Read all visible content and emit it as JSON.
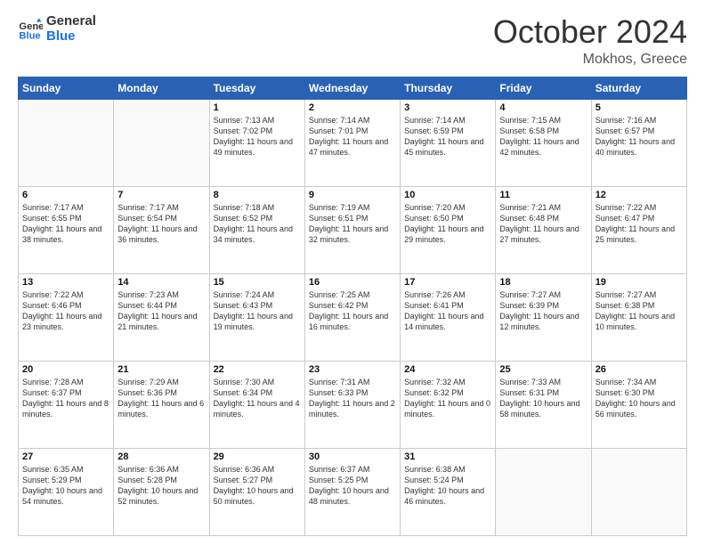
{
  "header": {
    "logo_line1": "General",
    "logo_line2": "Blue",
    "month": "October 2024",
    "location": "Mokhos, Greece"
  },
  "days_of_week": [
    "Sunday",
    "Monday",
    "Tuesday",
    "Wednesday",
    "Thursday",
    "Friday",
    "Saturday"
  ],
  "weeks": [
    [
      {
        "day": "",
        "info": ""
      },
      {
        "day": "",
        "info": ""
      },
      {
        "day": "1",
        "info": "Sunrise: 7:13 AM\nSunset: 7:02 PM\nDaylight: 11 hours and 49 minutes."
      },
      {
        "day": "2",
        "info": "Sunrise: 7:14 AM\nSunset: 7:01 PM\nDaylight: 11 hours and 47 minutes."
      },
      {
        "day": "3",
        "info": "Sunrise: 7:14 AM\nSunset: 6:59 PM\nDaylight: 11 hours and 45 minutes."
      },
      {
        "day": "4",
        "info": "Sunrise: 7:15 AM\nSunset: 6:58 PM\nDaylight: 11 hours and 42 minutes."
      },
      {
        "day": "5",
        "info": "Sunrise: 7:16 AM\nSunset: 6:57 PM\nDaylight: 11 hours and 40 minutes."
      }
    ],
    [
      {
        "day": "6",
        "info": "Sunrise: 7:17 AM\nSunset: 6:55 PM\nDaylight: 11 hours and 38 minutes."
      },
      {
        "day": "7",
        "info": "Sunrise: 7:17 AM\nSunset: 6:54 PM\nDaylight: 11 hours and 36 minutes."
      },
      {
        "day": "8",
        "info": "Sunrise: 7:18 AM\nSunset: 6:52 PM\nDaylight: 11 hours and 34 minutes."
      },
      {
        "day": "9",
        "info": "Sunrise: 7:19 AM\nSunset: 6:51 PM\nDaylight: 11 hours and 32 minutes."
      },
      {
        "day": "10",
        "info": "Sunrise: 7:20 AM\nSunset: 6:50 PM\nDaylight: 11 hours and 29 minutes."
      },
      {
        "day": "11",
        "info": "Sunrise: 7:21 AM\nSunset: 6:48 PM\nDaylight: 11 hours and 27 minutes."
      },
      {
        "day": "12",
        "info": "Sunrise: 7:22 AM\nSunset: 6:47 PM\nDaylight: 11 hours and 25 minutes."
      }
    ],
    [
      {
        "day": "13",
        "info": "Sunrise: 7:22 AM\nSunset: 6:46 PM\nDaylight: 11 hours and 23 minutes."
      },
      {
        "day": "14",
        "info": "Sunrise: 7:23 AM\nSunset: 6:44 PM\nDaylight: 11 hours and 21 minutes."
      },
      {
        "day": "15",
        "info": "Sunrise: 7:24 AM\nSunset: 6:43 PM\nDaylight: 11 hours and 19 minutes."
      },
      {
        "day": "16",
        "info": "Sunrise: 7:25 AM\nSunset: 6:42 PM\nDaylight: 11 hours and 16 minutes."
      },
      {
        "day": "17",
        "info": "Sunrise: 7:26 AM\nSunset: 6:41 PM\nDaylight: 11 hours and 14 minutes."
      },
      {
        "day": "18",
        "info": "Sunrise: 7:27 AM\nSunset: 6:39 PM\nDaylight: 11 hours and 12 minutes."
      },
      {
        "day": "19",
        "info": "Sunrise: 7:27 AM\nSunset: 6:38 PM\nDaylight: 11 hours and 10 minutes."
      }
    ],
    [
      {
        "day": "20",
        "info": "Sunrise: 7:28 AM\nSunset: 6:37 PM\nDaylight: 11 hours and 8 minutes."
      },
      {
        "day": "21",
        "info": "Sunrise: 7:29 AM\nSunset: 6:36 PM\nDaylight: 11 hours and 6 minutes."
      },
      {
        "day": "22",
        "info": "Sunrise: 7:30 AM\nSunset: 6:34 PM\nDaylight: 11 hours and 4 minutes."
      },
      {
        "day": "23",
        "info": "Sunrise: 7:31 AM\nSunset: 6:33 PM\nDaylight: 11 hours and 2 minutes."
      },
      {
        "day": "24",
        "info": "Sunrise: 7:32 AM\nSunset: 6:32 PM\nDaylight: 11 hours and 0 minutes."
      },
      {
        "day": "25",
        "info": "Sunrise: 7:33 AM\nSunset: 6:31 PM\nDaylight: 10 hours and 58 minutes."
      },
      {
        "day": "26",
        "info": "Sunrise: 7:34 AM\nSunset: 6:30 PM\nDaylight: 10 hours and 56 minutes."
      }
    ],
    [
      {
        "day": "27",
        "info": "Sunrise: 6:35 AM\nSunset: 5:29 PM\nDaylight: 10 hours and 54 minutes."
      },
      {
        "day": "28",
        "info": "Sunrise: 6:36 AM\nSunset: 5:28 PM\nDaylight: 10 hours and 52 minutes."
      },
      {
        "day": "29",
        "info": "Sunrise: 6:36 AM\nSunset: 5:27 PM\nDaylight: 10 hours and 50 minutes."
      },
      {
        "day": "30",
        "info": "Sunrise: 6:37 AM\nSunset: 5:25 PM\nDaylight: 10 hours and 48 minutes."
      },
      {
        "day": "31",
        "info": "Sunrise: 6:38 AM\nSunset: 5:24 PM\nDaylight: 10 hours and 46 minutes."
      },
      {
        "day": "",
        "info": ""
      },
      {
        "day": "",
        "info": ""
      }
    ]
  ]
}
